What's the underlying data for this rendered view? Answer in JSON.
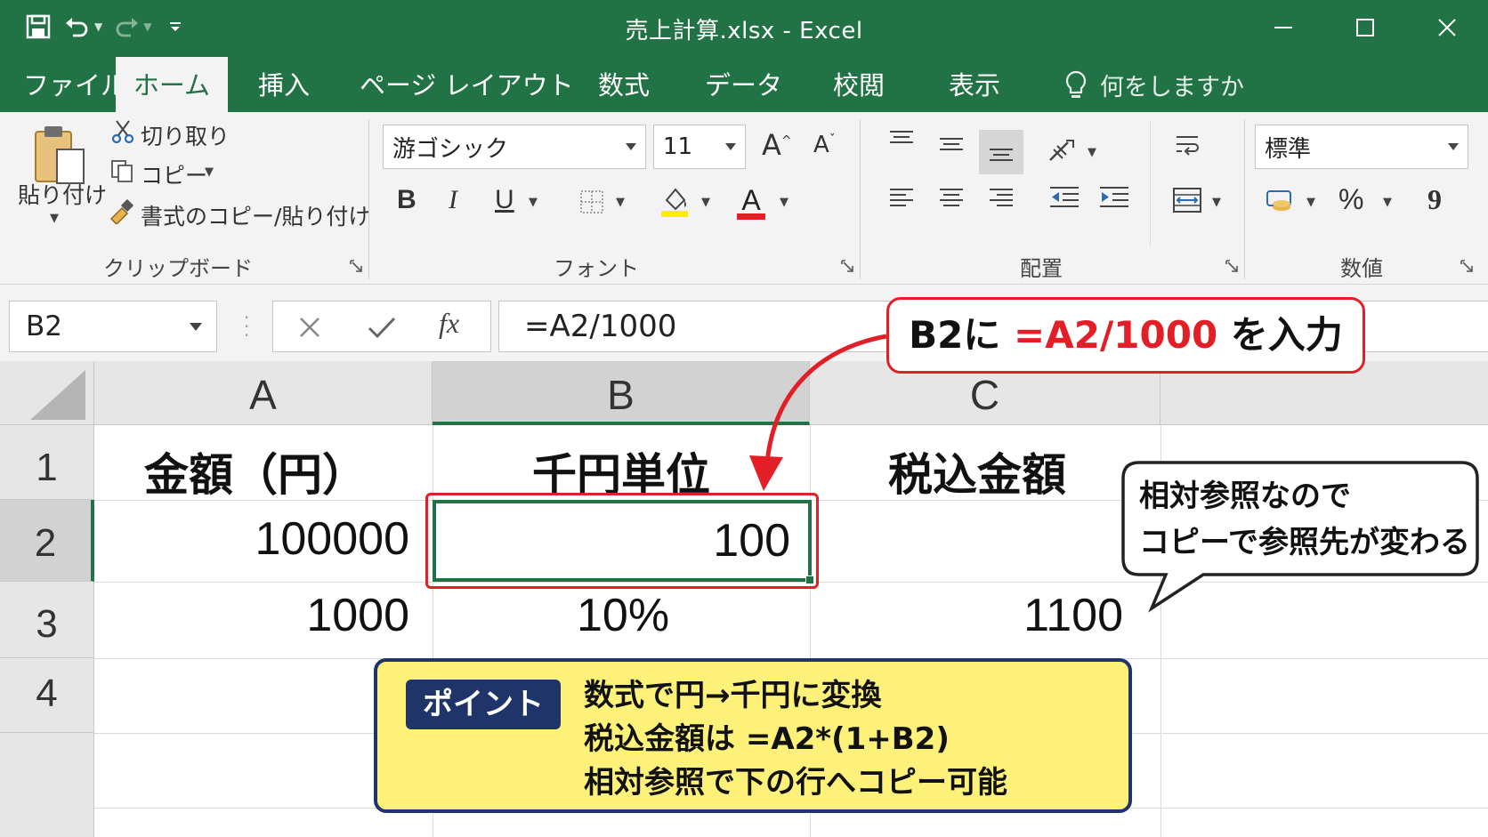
{
  "window": {
    "title": "売上計算.xlsx  -  Excel",
    "accent": "#217346"
  },
  "tabs": [
    {
      "label": "ファイル"
    },
    {
      "label": "ホーム"
    },
    {
      "label": "挿入"
    },
    {
      "label": "ページ レイアウト"
    },
    {
      "label": "数式"
    },
    {
      "label": "データ"
    },
    {
      "label": "校閲"
    },
    {
      "label": "表示"
    }
  ],
  "tell_me": "何をしますか",
  "ribbon": {
    "clipboard": {
      "paste": "貼り付け",
      "cut": "切り取り",
      "copy": "コピー",
      "format_painter": "書式のコピー/貼り付け",
      "label": "クリップボード"
    },
    "font": {
      "font_name": "游ゴシック",
      "font_size": "11",
      "bold": "B",
      "italic": "I",
      "underline": "U",
      "font_color_letter": "A",
      "grow": "A",
      "shrink": "A",
      "label": "フォント"
    },
    "alignment": {
      "label": "配置"
    },
    "number": {
      "format": "標準",
      "percent": "%",
      "comma": "9",
      "label": "数値"
    }
  },
  "formula_bar": {
    "name_box": "B2",
    "fx": "fx",
    "formula": "=A2/1000"
  },
  "sheet": {
    "columns": [
      "A",
      "B",
      "C"
    ],
    "rows": [
      "1",
      "2",
      "3",
      "4"
    ],
    "cells": {
      "A1": "金額（円）",
      "B1": "千円単位",
      "C1": "税込金額",
      "A2": "100000",
      "B2": "100",
      "A3": "1000",
      "B3": "10%",
      "C3": "1100"
    },
    "selected_cell": "B2"
  },
  "annotations": {
    "input_callout": {
      "prefix": "B2に ",
      "formula": "=A2/1000",
      "suffix": " を入力"
    },
    "bubble": {
      "line1": "相対参照なので",
      "line2": "コピーで参照先が変わる"
    },
    "point": {
      "badge": "ポイント",
      "lines": [
        "数式で円→千円に変換",
        "税込金額は =A2*(1+B2)",
        "相対参照で下の行へコピー可能"
      ]
    },
    "colors": {
      "callout_red": "#e21f26",
      "point_bg": "#fdf17a",
      "point_navy": "#1f3468"
    }
  }
}
